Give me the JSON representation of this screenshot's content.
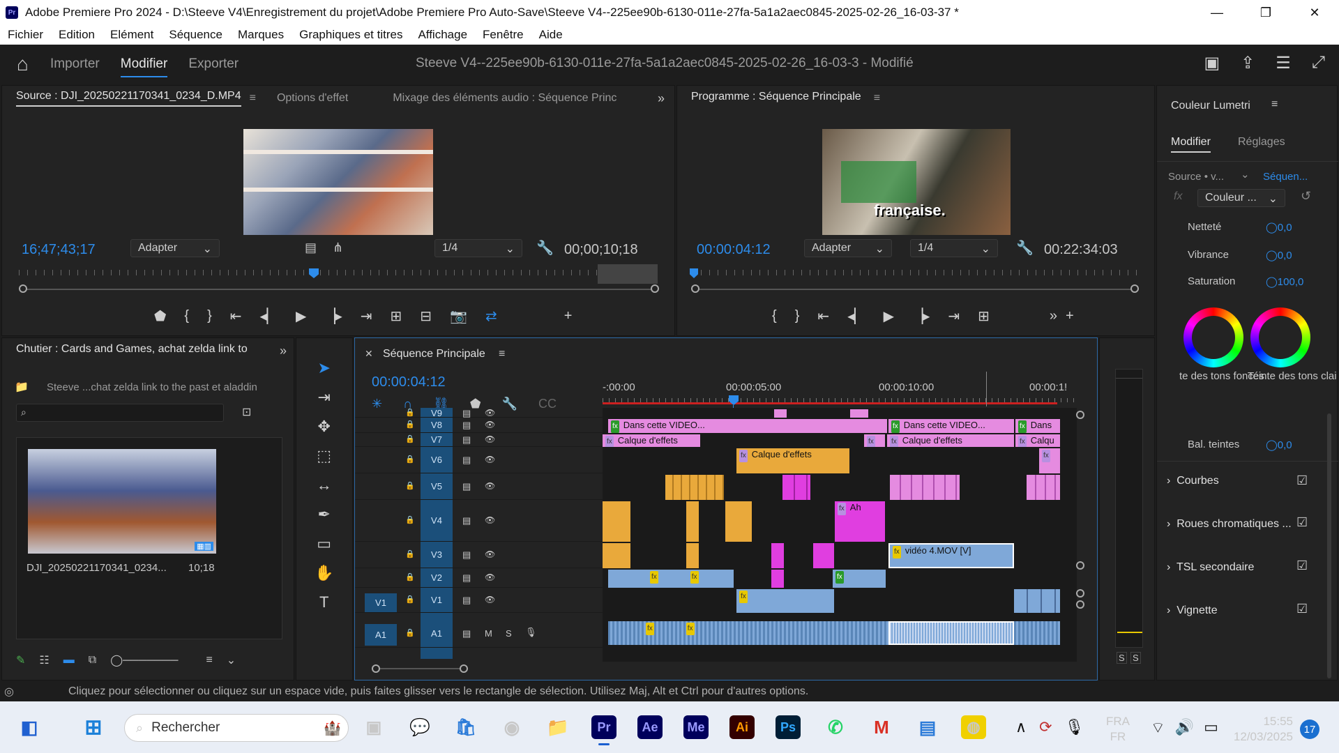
{
  "app": {
    "title": "Adobe Premiere Pro 2024 - D:\\Steeve V4\\Enregistrement du projet\\Adobe Premiere Pro Auto-Save\\Steeve V4--225ee90b-6130-011e-27fa-5a1a2aec0845-2025-02-26_16-03-37 *",
    "logo": "Pr"
  },
  "menu": [
    "Fichier",
    "Edition",
    "Elément",
    "Séquence",
    "Marques",
    "Graphiques et titres",
    "Affichage",
    "Fenêtre",
    "Aide"
  ],
  "header": {
    "workspaces": [
      "Importer",
      "Modifier",
      "Exporter"
    ],
    "active_workspace": "Modifier",
    "document": "Steeve V4--225ee90b-6130-011e-27fa-5a1a2aec0845-2025-02-26_16-03-3 - Modifié"
  },
  "source_monitor": {
    "tabs": [
      "Source : DJI_20250221170341_0234_D.MP4",
      "Options d'effet",
      "Mixage des éléments audio : Séquence Princ"
    ],
    "timecode": "16;47;43;17",
    "fit": "Adapter",
    "resolution": "1/4",
    "duration": "00;00;10;18"
  },
  "program_monitor": {
    "tab": "Programme : Séquence Principale",
    "timecode": "00:00:04:12",
    "fit": "Adapter",
    "resolution": "1/4",
    "duration": "00:22:34:03",
    "frame_caption": "française."
  },
  "lumetri": {
    "title": "Couleur Lumetri",
    "tabs": [
      "Modifier",
      "Réglages"
    ],
    "source": "Source • v...",
    "sequence": "Séquen...",
    "effect": "Couleur ...",
    "params": [
      {
        "label": "Netteté",
        "value": "0,0"
      },
      {
        "label": "Vibrance",
        "value": "0,0"
      },
      {
        "label": "Saturation",
        "value": "100,0"
      }
    ],
    "wheel_labels": [
      "te des tons foncés",
      "Teinte des tons clai"
    ],
    "balance": {
      "label": "Bal. teintes",
      "value": "0,0"
    },
    "sections": [
      "Courbes",
      "Roues chromatiques ...",
      "TSL secondaire",
      "Vignette"
    ]
  },
  "bin": {
    "tab": "Chutier : Cards and Games, achat zelda link to",
    "path": "Steeve ...chat zelda link to the past et aladdin",
    "item_name": "DJI_20250221170341_0234...",
    "item_duration": "10;18"
  },
  "timeline": {
    "tab": "Séquence Principale",
    "timecode": "00:00:04:12",
    "ruler": [
      "-:00:00",
      "00:00:05:00",
      "00:00:10:00",
      "00:00:1!"
    ],
    "tracks": [
      "V9",
      "V8",
      "V7",
      "V6",
      "V5",
      "V4",
      "V3",
      "V2",
      "V1",
      "A1"
    ],
    "source_patch": [
      "V1",
      "A1"
    ],
    "audio_buttons": [
      "M",
      "S"
    ],
    "clips": {
      "v8a": "Dans cette VIDEO...",
      "v8b": "Dans cette VIDEO...",
      "v8c": "Dans",
      "v7a": "Calque d'effets",
      "v7b": "Calque d'effets",
      "v7c": "Calqu",
      "v6a": "Calque d'effets",
      "v4a": "Ah",
      "v3a": "vidéo 4.MOV [V]"
    },
    "meter_labels": [
      "S",
      "S"
    ]
  },
  "status": "Cliquez pour sélectionner ou cliquez sur un espace vide, puis faites glisser vers le rectangle de sélection. Utilisez Maj, Alt et Ctrl pour d'autres options.",
  "taskbar": {
    "search": "Rechercher",
    "apps": [
      "Pr",
      "Ae",
      "Me",
      "Ai",
      "Ps"
    ],
    "lang": "FRA",
    "region": "FR",
    "time": "15:55",
    "date": "12/03/2025",
    "notif": "17"
  },
  "colors": {
    "accent": "#2d8ceb",
    "clip_orange": "#e9a93b",
    "clip_pink": "#e58be0",
    "clip_magenta": "#e03ee0",
    "clip_blue": "#7fa8d8"
  }
}
